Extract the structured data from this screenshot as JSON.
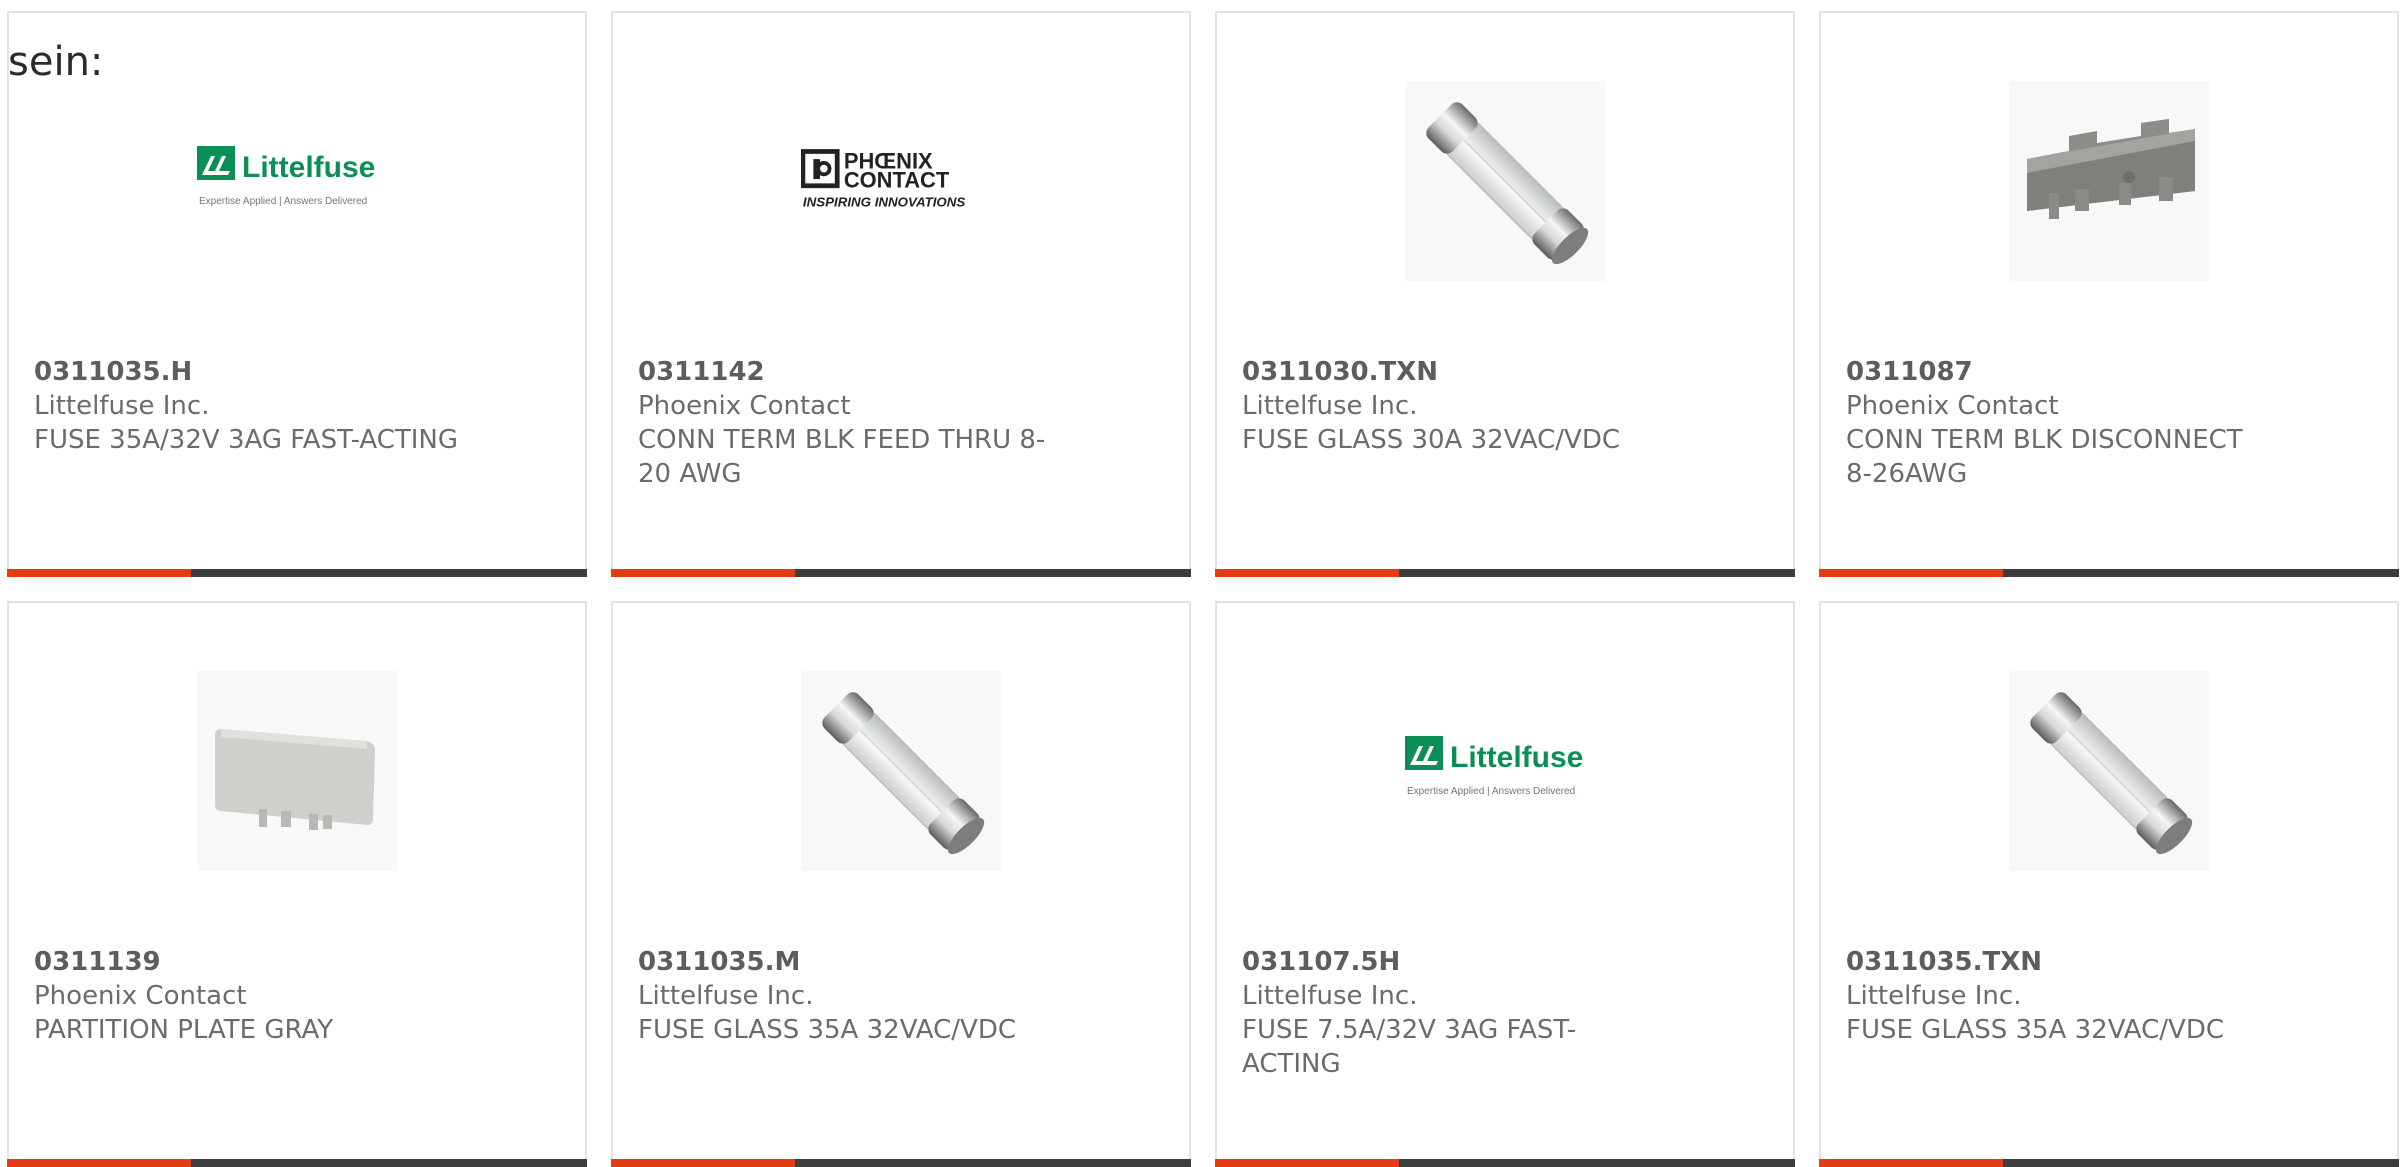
{
  "lead_text": "sein:",
  "colors": {
    "accent_bar": "#e43c12",
    "dark_bar": "#3d3d3d",
    "card_border": "#e3e3e3",
    "littelfuse_green": "#0c8f56"
  },
  "products": [
    {
      "part_number": "0311035.H",
      "manufacturer": "Littelfuse Inc.",
      "description": "FUSE 35A/32V 3AG FAST-ACTING",
      "image": "littelfuse-logo",
      "logo_text": {
        "brand": "Littelfuse",
        "tagline": "Expertise Applied | Answers Delivered"
      }
    },
    {
      "part_number": "0311142",
      "manufacturer": "Phoenix Contact",
      "description": "CONN TERM BLK FEED THRU 8-20 AWG",
      "image": "phoenix-contact-logo",
      "logo_text": {
        "line1": "PHŒNIX",
        "line2": "CONTACT",
        "tagline": "INSPIRING INNOVATIONS"
      }
    },
    {
      "part_number": "0311030.TXN",
      "manufacturer": "Littelfuse Inc.",
      "description": "FUSE GLASS 30A 32VAC/VDC",
      "image": "glass-fuse-photo"
    },
    {
      "part_number": "0311087",
      "manufacturer": "Phoenix Contact",
      "description": "CONN TERM BLK DISCONNECT 8-26AWG",
      "image": "terminal-block-photo"
    },
    {
      "part_number": "0311139",
      "manufacturer": "Phoenix Contact",
      "description": "PARTITION PLATE GRAY",
      "image": "partition-plate-photo"
    },
    {
      "part_number": "0311035.M",
      "manufacturer": "Littelfuse Inc.",
      "description": "FUSE GLASS 35A 32VAC/VDC",
      "image": "glass-fuse-photo"
    },
    {
      "part_number": "031107.5H",
      "manufacturer": "Littelfuse Inc.",
      "description": "FUSE 7.5A/32V 3AG FAST-ACTING",
      "image": "littelfuse-logo",
      "logo_text": {
        "brand": "Littelfuse",
        "tagline": "Expertise Applied | Answers Delivered"
      }
    },
    {
      "part_number": "0311035.TXN",
      "manufacturer": "Littelfuse Inc.",
      "description": "FUSE GLASS 35A 32VAC/VDC",
      "image": "glass-fuse-photo"
    }
  ]
}
